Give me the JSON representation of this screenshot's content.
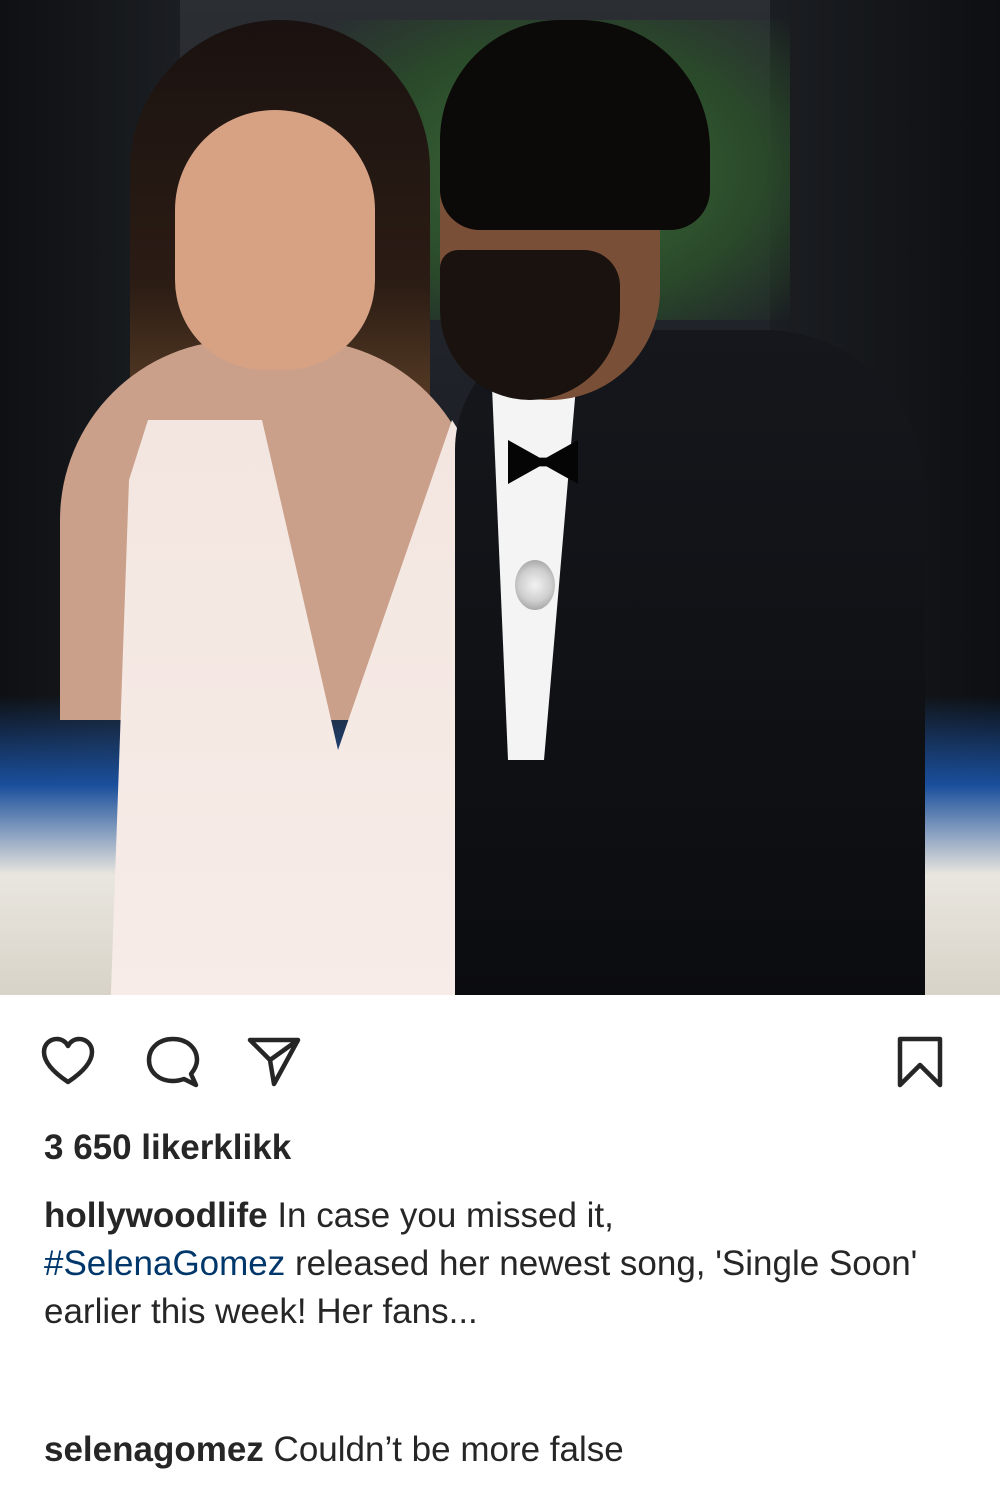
{
  "photo": {
    "alt": ""
  },
  "actions": {
    "like_icon": "heart-icon",
    "comment_icon": "comment-bubble-icon",
    "share_icon": "paper-plane-icon",
    "save_icon": "bookmark-icon"
  },
  "likes": {
    "text": "3 650 likerklikk"
  },
  "caption": {
    "username": "hollywoodlife",
    "text_before_tag": " In case you missed it,",
    "hashtag": "#SelenaGomez",
    "text_after_tag": " released her newest song, 'Single Soon' earlier this week! Her fans..."
  },
  "comment": {
    "username": "selenagomez",
    "text": " Couldn’t be more false"
  },
  "colors": {
    "text": "#262626",
    "hashtag": "#00376b",
    "background": "#ffffff"
  }
}
